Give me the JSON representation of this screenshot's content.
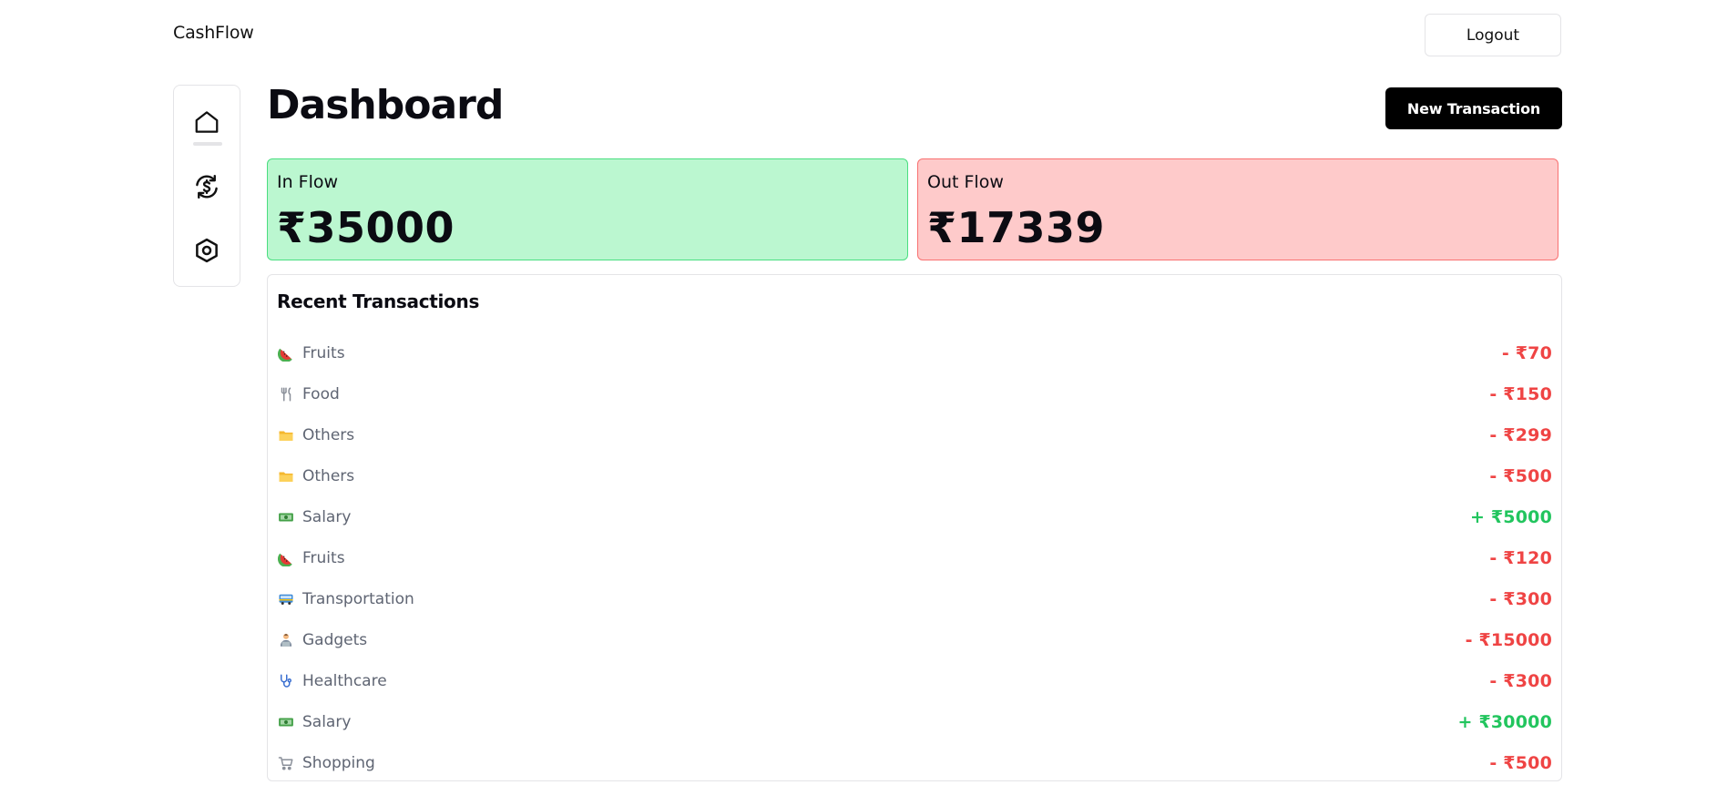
{
  "header": {
    "brand": "CashFlow",
    "logout_label": "Logout"
  },
  "sidebar": {
    "items": [
      {
        "icon": "home-icon"
      },
      {
        "icon": "dollar-exchange-icon"
      },
      {
        "icon": "settings-hexagon-icon"
      }
    ]
  },
  "page": {
    "title": "Dashboard",
    "new_transaction_label": "New Transaction"
  },
  "summary": {
    "inflow": {
      "label": "In Flow",
      "value": "₹35000"
    },
    "outflow": {
      "label": "Out Flow",
      "value": "₹17339"
    }
  },
  "recent": {
    "title": "Recent Transactions",
    "transactions": [
      {
        "icon": "watermelon-icon",
        "category": "Fruits",
        "amount": "- ₹70",
        "type": "debit"
      },
      {
        "icon": "fork-knife-icon",
        "category": "Food",
        "amount": "- ₹150",
        "type": "debit"
      },
      {
        "icon": "folder-icon",
        "category": "Others",
        "amount": "- ₹299",
        "type": "debit"
      },
      {
        "icon": "folder-icon",
        "category": "Others",
        "amount": "- ₹500",
        "type": "debit"
      },
      {
        "icon": "money-icon",
        "category": "Salary",
        "amount": "+ ₹5000",
        "type": "credit"
      },
      {
        "icon": "watermelon-icon",
        "category": "Fruits",
        "amount": "- ₹120",
        "type": "debit"
      },
      {
        "icon": "bus-icon",
        "category": "Transportation",
        "amount": "- ₹300",
        "type": "debit"
      },
      {
        "icon": "technologist-icon",
        "category": "Gadgets",
        "amount": "- ₹15000",
        "type": "debit"
      },
      {
        "icon": "stethoscope-icon",
        "category": "Healthcare",
        "amount": "- ₹300",
        "type": "debit"
      },
      {
        "icon": "money-icon",
        "category": "Salary",
        "amount": "+ ₹30000",
        "type": "credit"
      },
      {
        "icon": "cart-icon",
        "category": "Shopping",
        "amount": "- ₹500",
        "type": "debit"
      }
    ]
  },
  "colors": {
    "inflow_bg": "#bbf7d0",
    "outflow_bg": "#fecaca",
    "debit": "#ef4444",
    "credit": "#22c55e",
    "primary_button": "#000000"
  }
}
